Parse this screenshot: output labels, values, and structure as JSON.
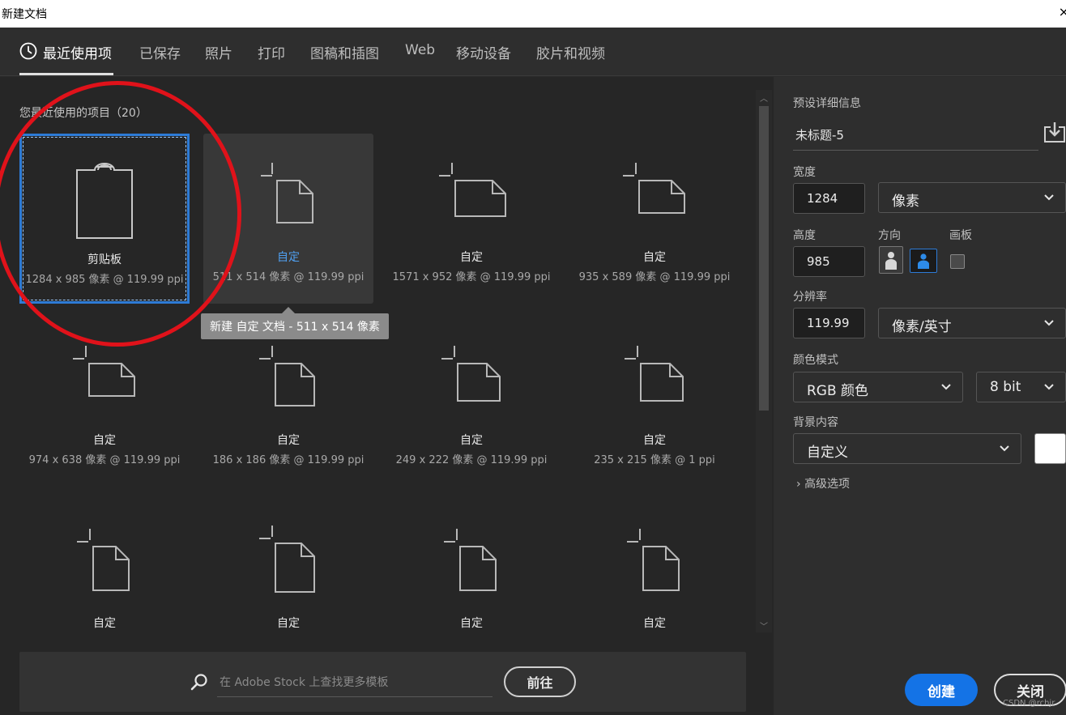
{
  "window": {
    "title": "新建文档",
    "close_glyph": "×"
  },
  "tabs": [
    {
      "label": "最近使用项",
      "active": true
    },
    {
      "label": "已保存"
    },
    {
      "label": "照片"
    },
    {
      "label": "打印"
    },
    {
      "label": "图稿和插图"
    },
    {
      "label": "Web"
    },
    {
      "label": "移动设备"
    },
    {
      "label": "胶片和视频"
    }
  ],
  "recent": {
    "title": "您最近使用的项目（20）",
    "items": [
      {
        "name": "剪贴板",
        "dims": "1284 x 985 像素 @ 119.99 ppi",
        "icon": "clipboard-icon",
        "state": "selected"
      },
      {
        "name": "自定",
        "dims": "511 x 514 像素 @ 119.99 ppi",
        "icon": "document-icon",
        "state": "hover"
      },
      {
        "name": "自定",
        "dims": "1571 x 952 像素 @ 119.99 ppi",
        "icon": "document-icon"
      },
      {
        "name": "自定",
        "dims": "935 x 589 像素 @ 119.99 ppi",
        "icon": "document-icon"
      },
      {
        "name": "自定",
        "dims": "974 x 638 像素 @ 119.99 ppi",
        "icon": "document-icon"
      },
      {
        "name": "自定",
        "dims": "186 x 186 像素 @ 119.99 ppi",
        "icon": "document-icon"
      },
      {
        "name": "自定",
        "dims": "249 x 222 像素 @ 119.99 ppi",
        "icon": "document-icon"
      },
      {
        "name": "自定",
        "dims": "235 x 215 像素 @ 1 ppi",
        "icon": "document-icon"
      },
      {
        "name": "自定",
        "dims": "",
        "icon": "document-icon"
      },
      {
        "name": "自定",
        "dims": "",
        "icon": "document-icon"
      },
      {
        "name": "自定",
        "dims": "",
        "icon": "document-icon"
      },
      {
        "name": "自定",
        "dims": "",
        "icon": "document-icon"
      }
    ],
    "tooltip": "新建 自定 文档 - 511 x 514 像素"
  },
  "stock": {
    "placeholder": "在 Adobe Stock 上查找更多模板",
    "go_label": "前往"
  },
  "preset": {
    "header": "预设详细信息",
    "doc_name": "未标题-5",
    "width_label": "宽度",
    "width_value": "1284",
    "width_unit": "像素",
    "height_label": "高度",
    "height_value": "985",
    "orientation_label": "方向",
    "artboard_label": "画板",
    "resolution_label": "分辨率",
    "resolution_value": "119.99",
    "resolution_unit": "像素/英寸",
    "color_mode_label": "颜色模式",
    "color_mode": "RGB 颜色",
    "bit_depth": "8 bit",
    "background_label": "背景内容",
    "background": "自定义",
    "background_color": "#ffffff",
    "advanced": "高级选项",
    "advanced_glyph": "›"
  },
  "actions": {
    "create": "创建",
    "close": "关闭"
  },
  "watermark": "CSDN @rchjr",
  "colors": {
    "accent": "#1473e6",
    "selection": "#2d7bd6",
    "annotation": "#e0121a",
    "hover_link": "#4f9ff0"
  }
}
